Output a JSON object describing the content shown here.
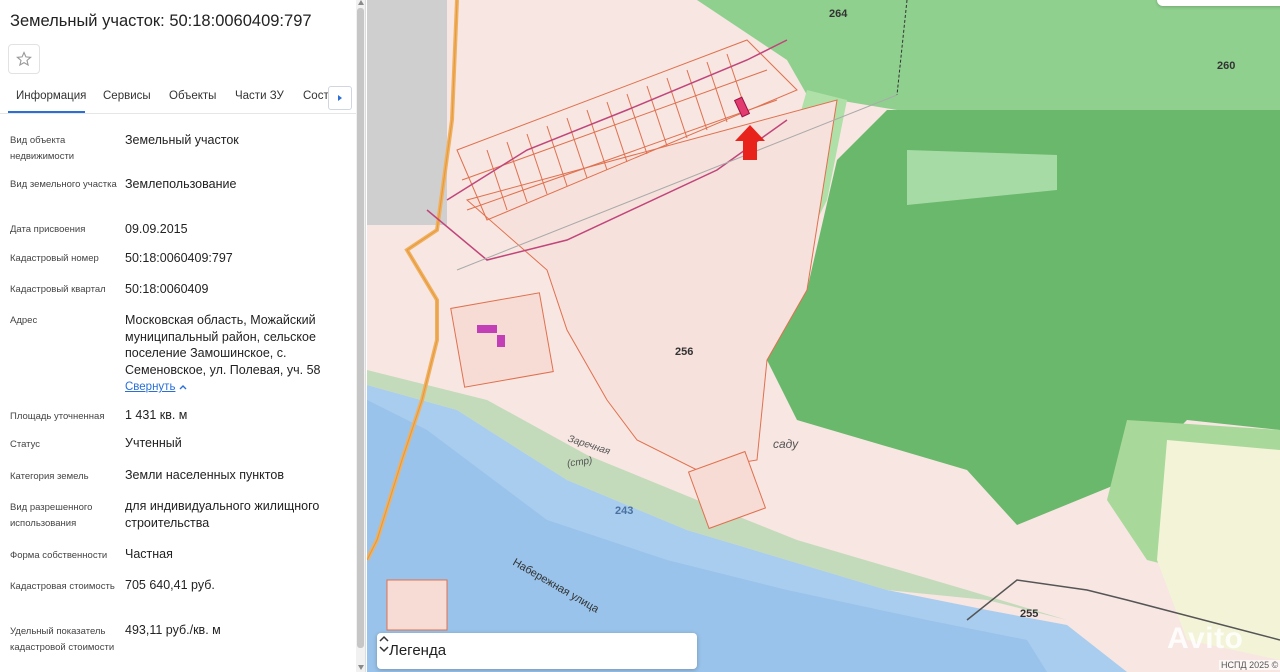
{
  "panel": {
    "title": "Земельный участок: 50:18:0060409:797",
    "tabs": [
      "Информация",
      "Сервисы",
      "Объекты",
      "Части ЗУ",
      "Состав"
    ],
    "active_tab": "Информация",
    "fields": [
      {
        "label": "Вид объекта недвижимости",
        "value": "Земельный участок"
      },
      {
        "label": "Вид земельного участка",
        "value": "Землепользование"
      },
      {
        "label": "Дата присвоения",
        "value": "09.09.2015"
      },
      {
        "label": "Кадастровый номер",
        "value": "50:18:0060409:797"
      },
      {
        "label": "Кадастровый квартал",
        "value": "50:18:0060409"
      },
      {
        "label": "Адрес",
        "value": "Московская область, Можайский муниципальный район, сельское поселение Замошинское, с. Семеновское, ул. Полевая, уч. 58"
      },
      {
        "label": "Площадь уточненная",
        "value": "1 431 кв. м"
      },
      {
        "label": "Статус",
        "value": "Учтенный"
      },
      {
        "label": "Категория земель",
        "value": "Земли населенных пунктов"
      },
      {
        "label": "Вид разрешенного использования",
        "value": "для индивидуального жилищного строительства"
      },
      {
        "label": "Форма собственности",
        "value": "Частная"
      },
      {
        "label": "Кадастровая стоимость",
        "value": "705 640,41 руб."
      },
      {
        "label": "Удельный показатель кадастровой стоимости",
        "value": "493,11 руб./кв. м"
      }
    ],
    "collapse_link": "Свернуть"
  },
  "map": {
    "labels": {
      "h264": "264",
      "h260": "260",
      "h256": "256",
      "h255": "255",
      "h243": "243",
      "sadu": "саду",
      "street": "Набережная улица",
      "street2": "(стр)",
      "zarech": "Заречная"
    },
    "legend_label": "Легенда",
    "watermark": "Avito",
    "copyright": "НСПД 2025 ©"
  },
  "colors": {
    "accent": "#2a6fd6",
    "forest": "#6fbf6f",
    "parcel_line": "#e0704d",
    "water": "#a9cdee",
    "marker": "#e8231c"
  }
}
